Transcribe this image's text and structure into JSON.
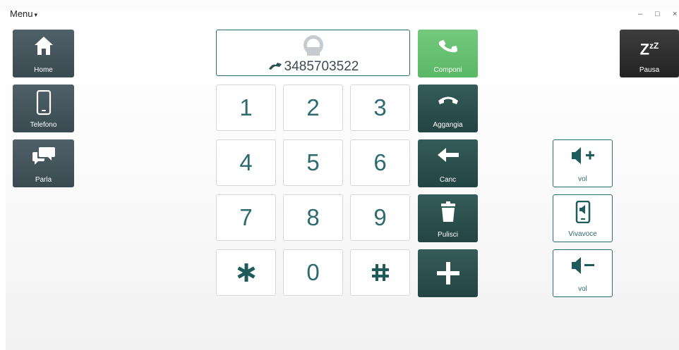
{
  "menu": {
    "label": "Menu"
  },
  "window_controls": {
    "minimize": "–",
    "maximize": "□",
    "close": "×"
  },
  "nav": [
    {
      "label": "Home",
      "icon": "home-icon"
    },
    {
      "label": "Telefono",
      "icon": "phone-icon"
    },
    {
      "label": "Parla",
      "icon": "chat-icon"
    }
  ],
  "pause": {
    "label": "Pausa",
    "icon_text": "Z",
    "icon_sup": "zZ"
  },
  "display": {
    "number": "3485703522"
  },
  "keypad": {
    "k1": "1",
    "k2": "2",
    "k3": "3",
    "k4": "4",
    "k5": "5",
    "k6": "6",
    "k7": "7",
    "k8": "8",
    "k9": "9",
    "k0": "0"
  },
  "actions": {
    "call": "Componi",
    "hangup": "Aggangia",
    "delete": "Canc",
    "clear": "Pulisci"
  },
  "side": {
    "vol_up": "vol",
    "speaker": "Vivavoce",
    "vol_down": "vol"
  },
  "colors": {
    "accent": "#2f6b6e",
    "call_green": "#64bf70",
    "dark_button": "#2b4f4d",
    "nav_button": "#44545b"
  }
}
